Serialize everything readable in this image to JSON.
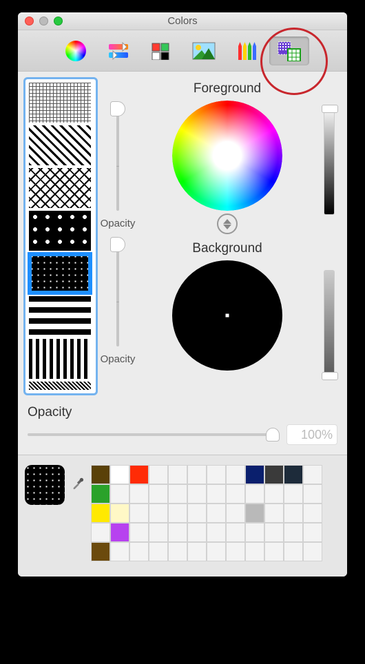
{
  "window": {
    "title": "Colors"
  },
  "toolbar": {
    "tabs": [
      "color-wheel",
      "sliders",
      "palettes",
      "image",
      "crayons",
      "pattern"
    ],
    "selected": "pattern"
  },
  "pattern_list": {
    "items": [
      "grid",
      "cross",
      "cross2",
      "big-dots",
      "dots",
      "hstripe",
      "vstripe",
      "thin"
    ],
    "selected_index": 4
  },
  "foreground": {
    "title": "Foreground",
    "opacity_label": "Opacity",
    "opacity_value": 100,
    "color": "#ffffff"
  },
  "background": {
    "title": "Background",
    "opacity_label": "Opacity",
    "opacity_value": 100,
    "color": "#000000"
  },
  "opacity_section": {
    "label": "Opacity",
    "value_text": "100%",
    "value": 100
  },
  "swatches": {
    "current_pattern": "dots",
    "rows": [
      [
        "#5a4108",
        "#ffffff",
        "#ff2b06",
        "",
        "",
        "",
        "",
        "",
        "#0a1f6d",
        "#3a3a3a",
        "#1d2b3a",
        ""
      ],
      [
        "#2aa22a",
        "",
        "",
        "",
        "",
        "",
        "",
        "",
        "",
        "",
        "",
        ""
      ],
      [
        "#ffe900",
        "#fff8c6",
        "",
        "",
        "",
        "",
        "",
        "",
        "#b9b9b9",
        "",
        "",
        ""
      ],
      [
        "",
        "#b742ef",
        "",
        "",
        "",
        "",
        "",
        "",
        "",
        "",
        "",
        ""
      ],
      [
        "#6b4a0d",
        "",
        "",
        "",
        "",
        "",
        "",
        "",
        "",
        "",
        "",
        ""
      ]
    ]
  },
  "annotation": {
    "highlight_tab": "pattern"
  }
}
